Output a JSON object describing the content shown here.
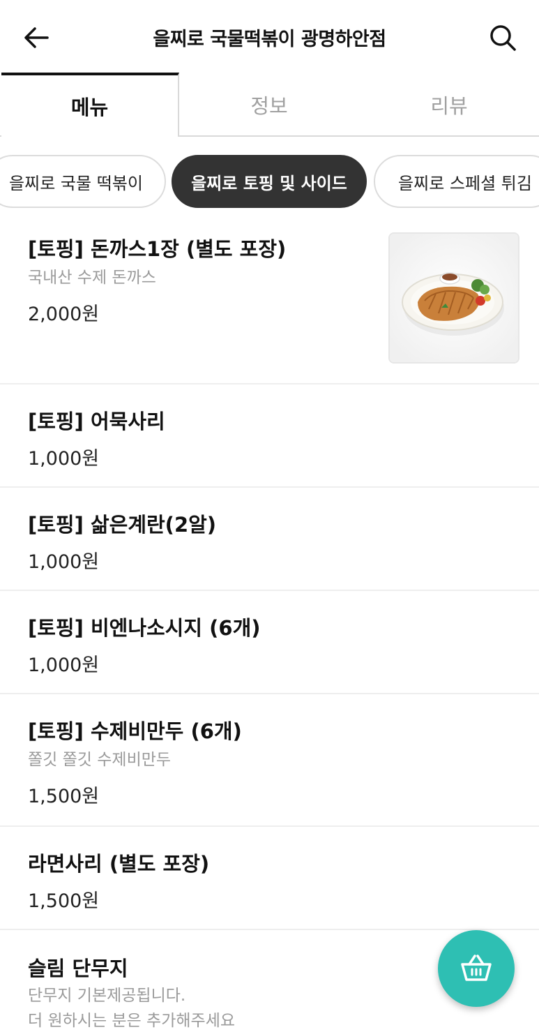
{
  "header": {
    "title": "을찌로 국물떡볶이 광명하안점",
    "back_icon": "arrow-left-icon",
    "search_icon": "search-icon"
  },
  "tabs": [
    {
      "label": "메뉴",
      "active": true
    },
    {
      "label": "정보",
      "active": false
    },
    {
      "label": "리뷰",
      "active": false
    }
  ],
  "categories": [
    {
      "label": "을찌로 국물 떡볶이",
      "active": false
    },
    {
      "label": "을찌로 토핑 및 사이드",
      "active": true
    },
    {
      "label": "을찌로 스페셜 튀김",
      "active": false
    }
  ],
  "menu_items": [
    {
      "name": "[토핑] 돈까스1장 (별도  포장)",
      "description": "국내산 수제 돈까스",
      "price": "2,000원",
      "has_image": true
    },
    {
      "name": "[토핑] 어묵사리",
      "price": "1,000원"
    },
    {
      "name": "[토핑] 삶은계란(2알)",
      "price": "1,000원"
    },
    {
      "name": "[토핑] 비엔나소시지 (6개)",
      "price": "1,000원"
    },
    {
      "name": "[토핑] 수제비만두 (6개)",
      "description": "쫄깃 쫄깃 수제비만두",
      "price": "1,500원"
    },
    {
      "name": "라면사리 (별도 포장)",
      "price": "1,500원"
    },
    {
      "name": "슬림 단무지",
      "description_lines": [
        "단무지 기본제공됩니다.",
        "더 원하시는 분은 추가해주세요"
      ]
    }
  ],
  "cart_button": {
    "icon": "shopping-basket-icon",
    "color": "#2ebfb3"
  },
  "colors": {
    "active_chip": "#333333",
    "accent": "#2ebfb3"
  }
}
